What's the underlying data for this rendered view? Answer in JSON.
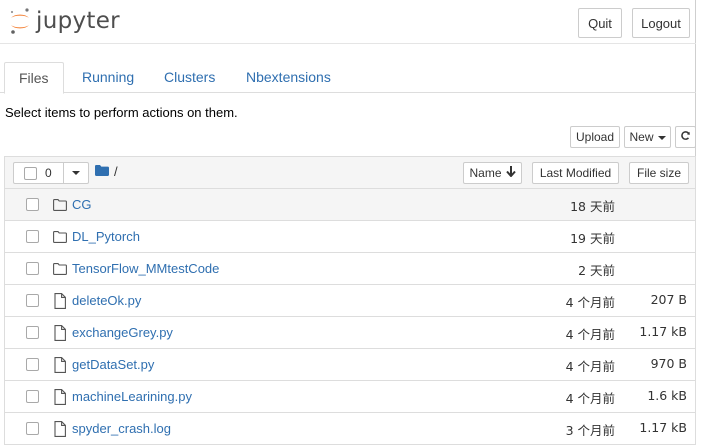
{
  "header": {
    "logo_text": "jupyter",
    "quit_label": "Quit",
    "logout_label": "Logout"
  },
  "tabs": [
    {
      "label": "Files",
      "active": true
    },
    {
      "label": "Running",
      "active": false
    },
    {
      "label": "Clusters",
      "active": false
    },
    {
      "label": "Nbextensions",
      "active": false
    }
  ],
  "toolbar": {
    "hint": "Select items to perform actions on them.",
    "upload_label": "Upload",
    "new_label": "New",
    "refresh_icon": "refresh-icon"
  },
  "list_header": {
    "selected_count": "0",
    "breadcrumb": "/",
    "name_label": "Name",
    "last_modified_label": "Last Modified",
    "file_size_label": "File size"
  },
  "items": [
    {
      "type": "folder",
      "name": "CG",
      "modified": "18 天前",
      "size": ""
    },
    {
      "type": "folder",
      "name": "DL_Pytorch",
      "modified": "19 天前",
      "size": ""
    },
    {
      "type": "folder",
      "name": "TensorFlow_MMtestCode",
      "modified": "2 天前",
      "size": ""
    },
    {
      "type": "file",
      "name": "deleteOk.py",
      "modified": "4 个月前",
      "size": "207 B"
    },
    {
      "type": "file",
      "name": "exchangeGrey.py",
      "modified": "4 个月前",
      "size": "1.17 kB"
    },
    {
      "type": "file",
      "name": "getDataSet.py",
      "modified": "4 个月前",
      "size": "970 B"
    },
    {
      "type": "file",
      "name": "machineLearining.py",
      "modified": "4 个月前",
      "size": "1.6 kB"
    },
    {
      "type": "file",
      "name": "spyder_crash.log",
      "modified": "3 个月前",
      "size": "1.17 kB"
    }
  ],
  "colors": {
    "link": "#2f6fb0",
    "logo_orange": "#f37726",
    "folder_blue": "#2f6fb0"
  }
}
